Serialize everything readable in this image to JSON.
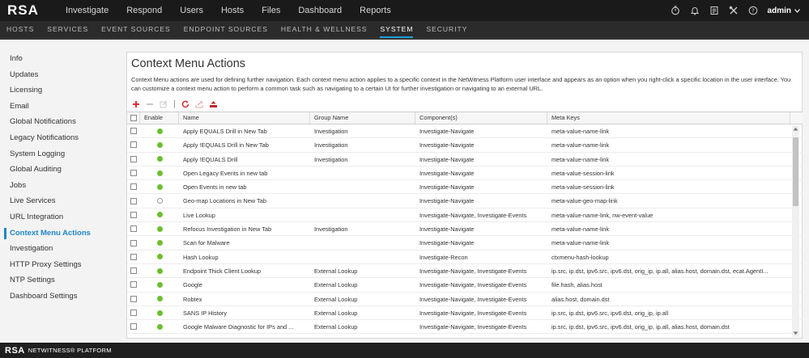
{
  "topbar": {
    "logo": "RSA",
    "nav": [
      "Investigate",
      "Respond",
      "Users",
      "Hosts",
      "Files",
      "Dashboard",
      "Reports"
    ],
    "icons": [
      "timer-icon",
      "bell-icon",
      "clipboard-icon",
      "tools-icon",
      "help-icon"
    ],
    "user": "admin"
  },
  "subnav": {
    "items": [
      "HOSTS",
      "SERVICES",
      "EVENT SOURCES",
      "ENDPOINT SOURCES",
      "HEALTH & WELLNESS",
      "SYSTEM",
      "SECURITY"
    ],
    "active": "SYSTEM",
    "accent_color": "#1f9ad6"
  },
  "sidebar": {
    "items": [
      "Info",
      "Updates",
      "Licensing",
      "Email",
      "Global Notifications",
      "Legacy Notifications",
      "System Logging",
      "Global Auditing",
      "Jobs",
      "Live Services",
      "URL Integration",
      "Context Menu Actions",
      "Investigation",
      "HTTP Proxy Settings",
      "NTP Settings",
      "Dashboard Settings"
    ],
    "active": "Context Menu Actions"
  },
  "panel": {
    "title": "Context Menu Actions",
    "description": "Context Menu actions are used for defining further navigation. Each context menu action applies to a specific context in the NetWitness Platform user interface and appears as an option when you right-click a specific location in the user interface. You can customize a context menu action to perform a common task such as navigating to a certain UI for further investigation or navigating to an external URL."
  },
  "toolbar": {
    "buttons": [
      "add-icon",
      "remove-icon",
      "edit-icon",
      "refresh-icon",
      "export-icon",
      "import-icon"
    ]
  },
  "table": {
    "headers": {
      "enable": "Enable",
      "name": "Name",
      "group": "Group Name",
      "components": "Component(s)",
      "meta": "Meta Keys"
    },
    "rows": [
      {
        "enabled": true,
        "name": "Apply EQUALS Drill in New Tab",
        "group": "Investigation",
        "components": "Investigate-Navigate",
        "meta": "meta-value-name-link"
      },
      {
        "enabled": true,
        "name": "Apply !EQUALS Drill in New Tab",
        "group": "Investigation",
        "components": "Investigate-Navigate",
        "meta": "meta-value-name-link"
      },
      {
        "enabled": true,
        "name": "Apply !EQUALS Drill",
        "group": "Investigation",
        "components": "Investigate-Navigate",
        "meta": "meta-value-name-link"
      },
      {
        "enabled": true,
        "name": "Open Legacy Events in new tab",
        "group": "",
        "components": "Investigate-Navigate",
        "meta": "meta-value-session-link"
      },
      {
        "enabled": true,
        "name": "Open Events in new tab",
        "group": "",
        "components": "Investigate-Navigate",
        "meta": "meta-value-session-link"
      },
      {
        "enabled": false,
        "name": "Geo-map Locations in New Tab",
        "group": "",
        "components": "Investigate-Navigate",
        "meta": "meta-value-geo-map-link"
      },
      {
        "enabled": true,
        "name": "Live Lookup",
        "group": "",
        "components": "Investigate-Navigate, Investigate-Events",
        "meta": "meta-value-name-link, nw-event-value"
      },
      {
        "enabled": true,
        "name": "Refocus Investigation in New Tab",
        "group": "Investigation",
        "components": "Investigate-Navigate",
        "meta": "meta-value-name-link"
      },
      {
        "enabled": true,
        "name": "Scan for Malware",
        "group": "",
        "components": "Investigate-Navigate",
        "meta": "meta-value-name-link"
      },
      {
        "enabled": true,
        "name": "Hash Lookup",
        "group": "",
        "components": "Investigate-Recon",
        "meta": "ctxmenu-hash-lookup"
      },
      {
        "enabled": true,
        "name": "Endpoint Thick Client Lookup",
        "group": "External Lookup",
        "components": "Investigate-Navigate, Investigate-Events",
        "meta": "ip.src, ip.dst, ipv6.src, ipv6.dst, orig_ip, ip.all, alias.host, domain.dst, ecat.AgentI..."
      },
      {
        "enabled": true,
        "name": "Google",
        "group": "External Lookup",
        "components": "Investigate-Navigate, Investigate-Events",
        "meta": "file.hash, alias.host"
      },
      {
        "enabled": true,
        "name": "Robtex",
        "group": "External Lookup",
        "components": "Investigate-Navigate, Investigate-Events",
        "meta": "alias.host, domain.dst"
      },
      {
        "enabled": true,
        "name": "SANS IP History",
        "group": "External Lookup",
        "components": "Investigate-Navigate, Investigate-Events",
        "meta": "ip.src, ip.dst, ipv6.src, ipv6.dst, orig_ip, ip.all"
      },
      {
        "enabled": true,
        "name": "Google Malware Diagnostic for IPs and ...",
        "group": "External Lookup",
        "components": "Investigate-Navigate, Investigate-Events",
        "meta": "ip.src, ip.dst, ipv6.src, ipv6.dst, orig_ip, ip.all, alias.host, domain.dst"
      }
    ]
  },
  "footer": {
    "brand": "RSA",
    "product": "NETWITNESS® PLATFORM"
  }
}
